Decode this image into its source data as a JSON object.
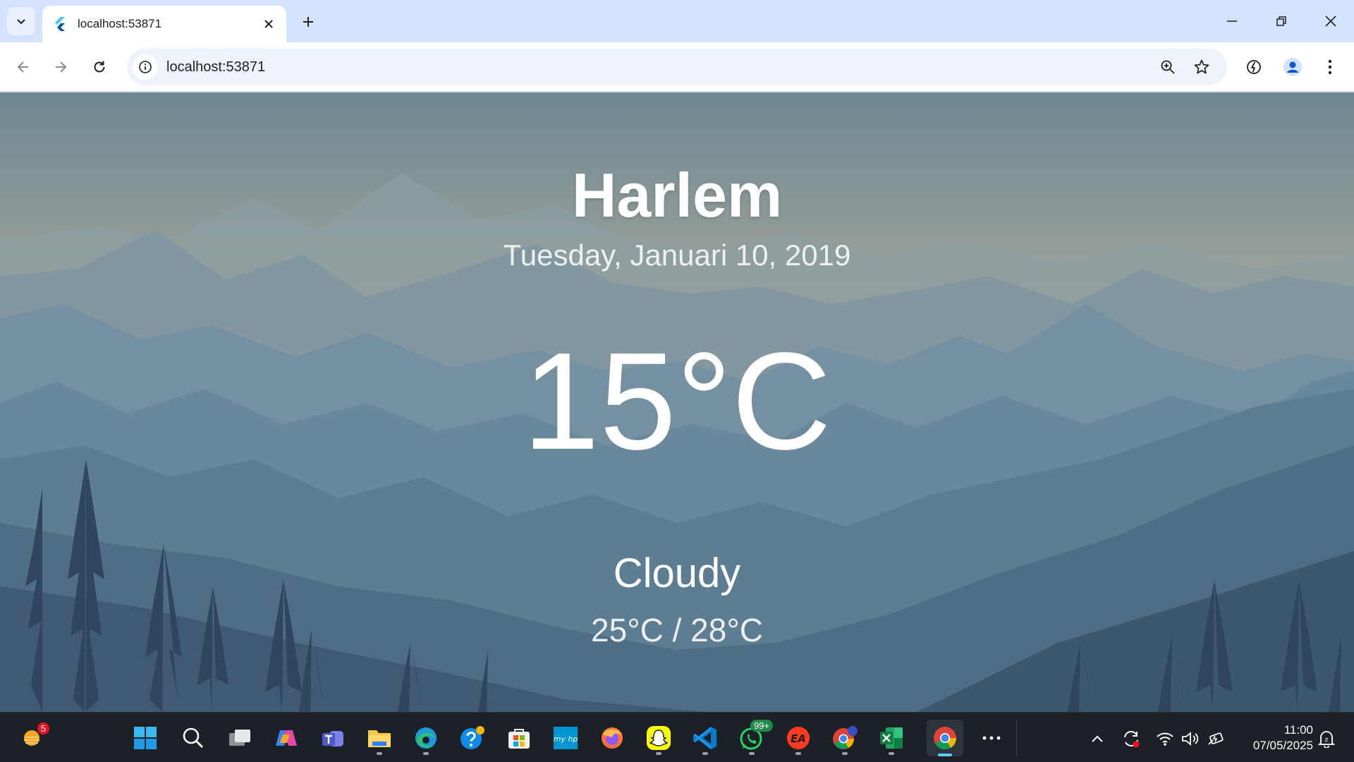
{
  "browser": {
    "tab_title": "localhost:53871",
    "url": "localhost:53871"
  },
  "weather": {
    "city": "Harlem",
    "date": "Tuesday, Januari 10, 2019",
    "temperature": "15°C",
    "condition": "Cloudy",
    "range": "25°C / 28°C"
  },
  "taskbar": {
    "weather_badge": "5",
    "whatsapp_badge": "99+",
    "time": "11:00",
    "date": "07/05/2025"
  },
  "colors": {
    "tabstrip": "#d3e3fd",
    "sky_top": "#6f8791",
    "sky_glow": "#b3a596",
    "taskbar": "#1c2128",
    "accent": "#60cdff"
  }
}
